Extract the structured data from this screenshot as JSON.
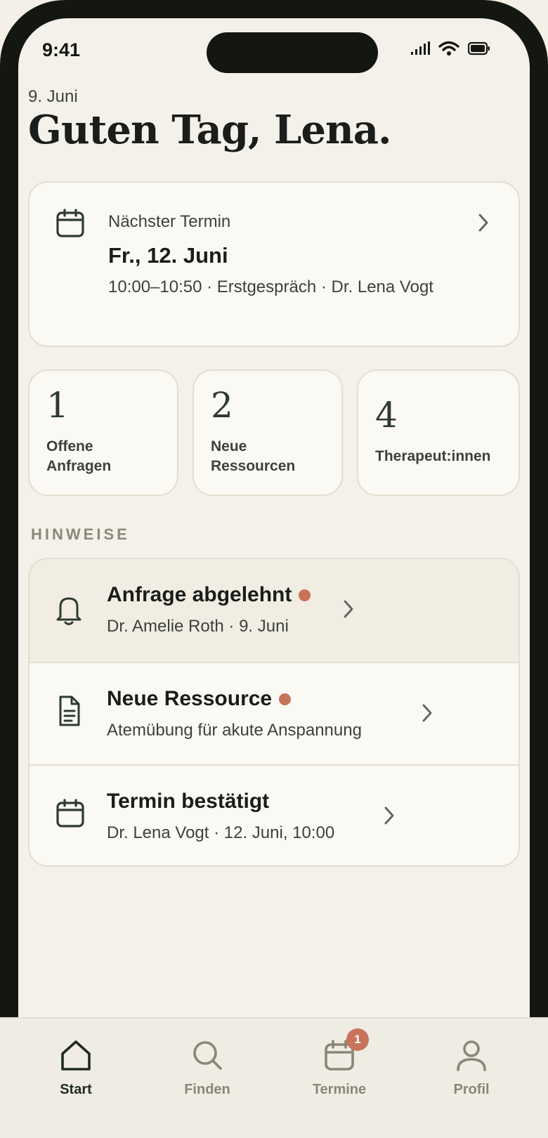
{
  "status_bar": {
    "time": "9:41"
  },
  "header": {
    "date": "9. Juni",
    "greeting": "Guten Tag, Lena."
  },
  "next_appointment": {
    "label": "Nächster Termin",
    "date": "Fr., 12. Juni",
    "detail": "10:00–10:50 · Erstgespräch · Dr. Lena Vogt"
  },
  "stats": [
    {
      "value": "1",
      "label": "Offene Anfragen"
    },
    {
      "value": "2",
      "label": "Neue Ressourcen"
    },
    {
      "value": "4",
      "label": "Therapeut:innen"
    }
  ],
  "notices": {
    "heading": "HINWEISE",
    "items": [
      {
        "title": "Anfrage abgelehnt",
        "subtitle": "Dr. Amelie Roth · 9. Juni",
        "icon": "bell-icon",
        "unread": true
      },
      {
        "title": "Neue Ressource",
        "subtitle": "Atemübung für akute Anspannung",
        "icon": "document-icon",
        "unread": true
      },
      {
        "title": "Termin bestätigt",
        "subtitle": "Dr. Lena Vogt · 12. Juni, 10:00",
        "icon": "calendar-icon",
        "unread": false
      }
    ]
  },
  "tabbar": {
    "items": [
      {
        "label": "Start",
        "icon": "home-icon",
        "active": true
      },
      {
        "label": "Finden",
        "icon": "search-icon",
        "active": false
      },
      {
        "label": "Termine",
        "icon": "calendar-icon",
        "active": false,
        "badge": "1"
      },
      {
        "label": "Profil",
        "icon": "person-icon",
        "active": false
      }
    ]
  },
  "colors": {
    "background": "#f4f1ea",
    "card": "#fbf9f3",
    "accent": "#c8745a",
    "text_primary": "#1a1d1a",
    "icon": "#2e3a32"
  }
}
